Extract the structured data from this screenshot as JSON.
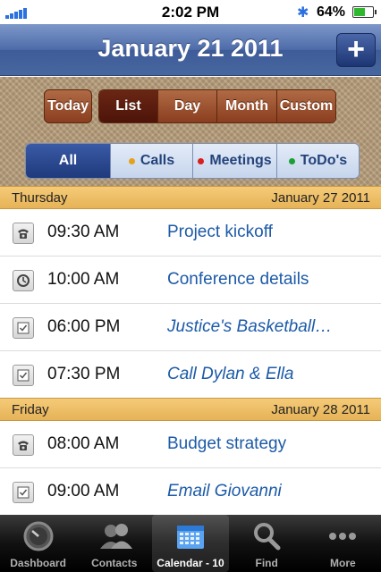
{
  "status_bar": {
    "time": "2:02 PM",
    "battery_percent": "64%",
    "battery_level": 0.64,
    "bluetooth": "bluetooth-icon",
    "signal_bars": 5
  },
  "navbar": {
    "title": "January 21 2011",
    "add_label": "+"
  },
  "toolbar": {
    "today_label": "Today",
    "views": [
      {
        "label": "List",
        "active": true
      },
      {
        "label": "Day",
        "active": false
      },
      {
        "label": "Month",
        "active": false
      },
      {
        "label": "Custom",
        "active": false
      }
    ],
    "filters": [
      {
        "label": "All",
        "active": true,
        "dot_color": null
      },
      {
        "label": "Calls",
        "active": false,
        "dot_color": "#e3a21a"
      },
      {
        "label": "Meetings",
        "active": false,
        "dot_color": "#d81e1e"
      },
      {
        "label": "ToDo's",
        "active": false,
        "dot_color": "#1aa036"
      }
    ]
  },
  "sections": [
    {
      "day": "Thursday",
      "date": "January 27 2011",
      "items": [
        {
          "icon": "phone-icon",
          "time": "09:30 AM",
          "title": "Project kickoff",
          "italic": false
        },
        {
          "icon": "clock-icon",
          "time": "10:00 AM",
          "title": "Conference details",
          "italic": false
        },
        {
          "icon": "checkbox-icon",
          "time": "06:00 PM",
          "title": "Justice's Basketball…",
          "italic": true
        },
        {
          "icon": "checkbox-icon",
          "time": "07:30 PM",
          "title": "Call Dylan & Ella",
          "italic": true
        }
      ]
    },
    {
      "day": "Friday",
      "date": "January 28 2011",
      "items": [
        {
          "icon": "phone-icon",
          "time": "08:00 AM",
          "title": "Budget strategy",
          "italic": false
        },
        {
          "icon": "checkbox-icon",
          "time": "09:00 AM",
          "title": "Email Giovanni",
          "italic": true
        }
      ]
    }
  ],
  "tabbar": [
    {
      "label": "Dashboard",
      "icon": "dashboard-gauge-icon",
      "active": false
    },
    {
      "label": "Contacts",
      "icon": "contacts-people-icon",
      "active": false
    },
    {
      "label": "Calendar - 10",
      "icon": "calendar-icon",
      "active": true
    },
    {
      "label": "Find",
      "icon": "magnifier-icon",
      "active": false
    },
    {
      "label": "More",
      "icon": "more-dots-icon",
      "active": false
    }
  ],
  "colors": {
    "nav_blue": "#4e6ca9",
    "accent_link": "#1c5aa8",
    "section_gold": "#e6b357",
    "segment_brown": "#8a3e1f"
  }
}
